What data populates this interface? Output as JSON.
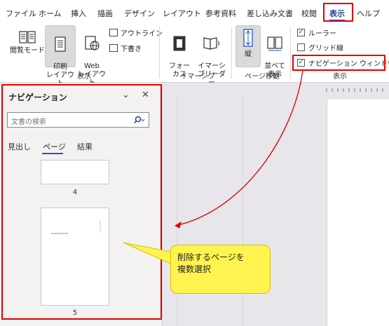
{
  "menu": {
    "items": [
      {
        "label": "ファイル"
      },
      {
        "label": "ホーム"
      },
      {
        "label": "挿入"
      },
      {
        "label": "描画"
      },
      {
        "label": "デザイン"
      },
      {
        "label": "レイアウト"
      },
      {
        "label": "参考資料"
      },
      {
        "label": "差し込み文書"
      },
      {
        "label": "校閲"
      },
      {
        "label": "表示"
      },
      {
        "label": "ヘルプ"
      }
    ],
    "active": "表示"
  },
  "ribbon": {
    "views": {
      "read_mode": "閲覧モード",
      "print_layout": "印刷\nレイアウト",
      "web_layout": "Web\nレイアウト",
      "outline": "アウトライン",
      "draft": "下書き",
      "group_label": "表示"
    },
    "immersive": {
      "focus": "フォー\nカス",
      "immersive_reader": "イマーシ\nブリーダー",
      "group_label": "イマーシブ"
    },
    "page_movement": {
      "vertical": "縦",
      "side_by_side": "並べて\n表示",
      "group_label": "ページ移動"
    },
    "show": {
      "ruler": "ルーラー",
      "gridlines": "グリッド線",
      "navigation_pane": "ナビゲーション ウィンドウ",
      "group_label": "表示",
      "ruler_checked": true,
      "gridlines_checked": false,
      "navigation_pane_checked": true
    }
  },
  "nav_pane": {
    "title": "ナビゲーション",
    "search_placeholder": "文書の検索",
    "tabs": [
      {
        "label": "見出し"
      },
      {
        "label": "ページ"
      },
      {
        "label": "結果"
      }
    ],
    "active_tab": "ページ",
    "thumbnails": [
      {
        "page": "4"
      },
      {
        "page": "5"
      }
    ]
  },
  "callout": {
    "text": "削除するページを\n複数選択"
  },
  "colors": {
    "highlight": "#e00000",
    "callout_fill": "#fff44f",
    "accent": "#1d57c7"
  }
}
